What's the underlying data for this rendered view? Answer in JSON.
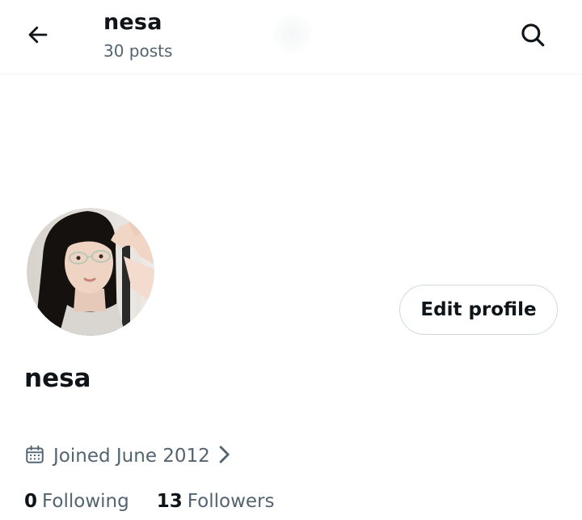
{
  "header": {
    "title": "nesa",
    "posts_count": "30 posts",
    "back_icon": "arrow-left-icon",
    "search_icon": "search-icon"
  },
  "profile": {
    "display_name": "nesa",
    "edit_button_label": "Edit profile",
    "joined": "Joined June 2012",
    "calendar_icon": "calendar-icon",
    "chevron_icon": "chevron-right-icon",
    "following_count": "0",
    "following_label": "Following",
    "followers_count": "13",
    "followers_label": "Followers"
  },
  "colors": {
    "text_primary": "#0f1419",
    "text_secondary": "#536471",
    "border": "#cfd9de",
    "background": "#ffffff"
  }
}
